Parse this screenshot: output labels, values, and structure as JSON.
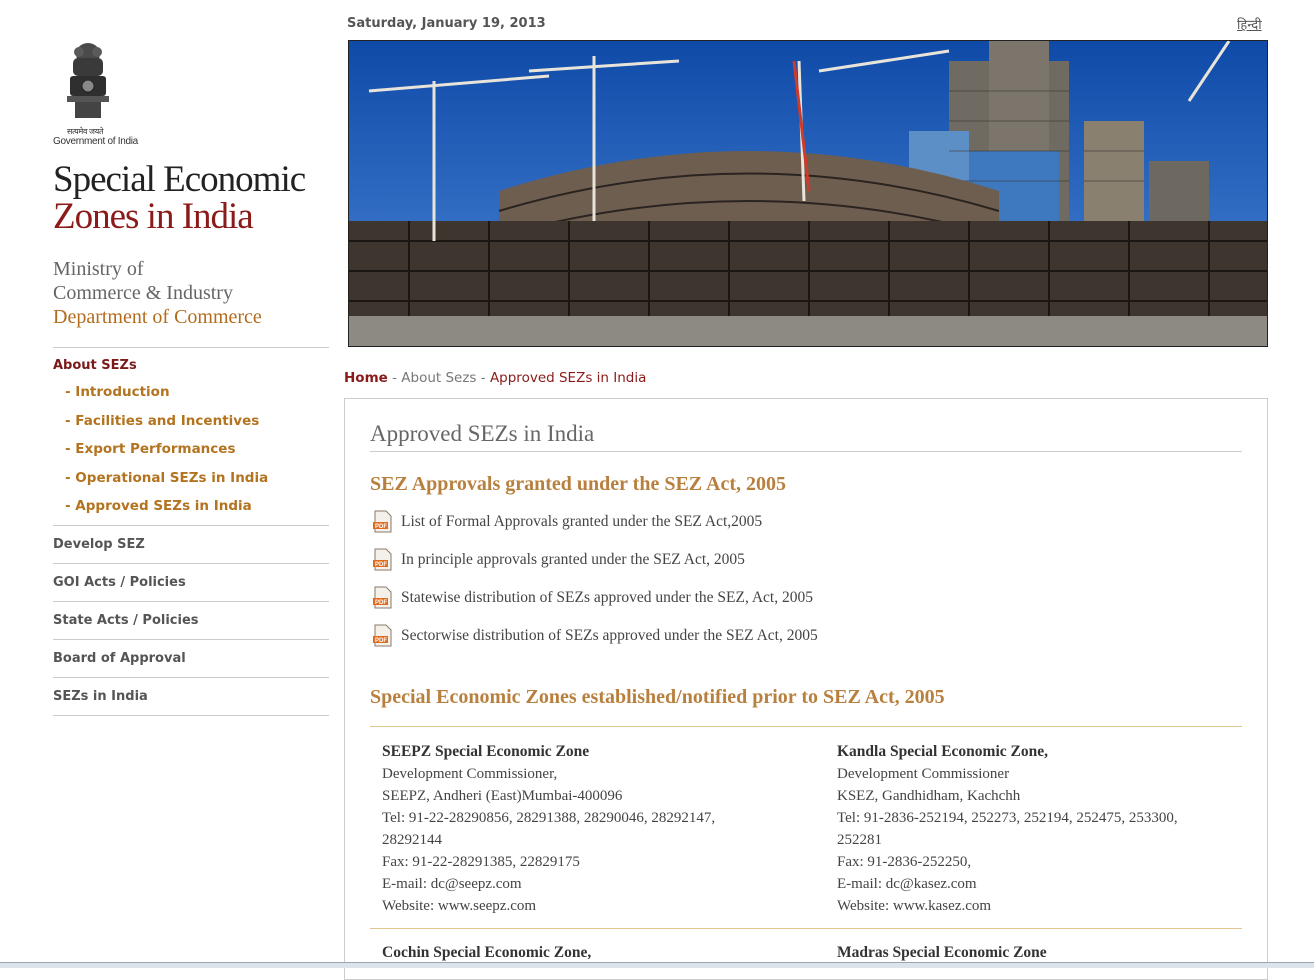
{
  "header": {
    "date": "Saturday, January 19, 2013",
    "language_link": "हिन्दी"
  },
  "branding": {
    "emblem_caption": "Government of India",
    "emblem_motto": "सत्यमेव जयते",
    "title_line1": "Special Economic",
    "title_line2": "Zones in India",
    "ministry_line1": "Ministry of",
    "ministry_line2": "Commerce & Industry",
    "department": "Department of Commerce"
  },
  "sidebar": {
    "active_section": "About SEZs",
    "sub_items": [
      {
        "label": "- Introduction"
      },
      {
        "label": "- Facilities and Incentives"
      },
      {
        "label": "- Export Performances"
      },
      {
        "label": "- Operational SEZs in India"
      },
      {
        "label": "- Approved SEZs in India"
      }
    ],
    "items": [
      {
        "label": "Develop SEZ"
      },
      {
        "label": "GOI Acts / Policies"
      },
      {
        "label": "State Acts / Policies"
      },
      {
        "label": "Board of Approval"
      },
      {
        "label": "SEZs in India"
      }
    ]
  },
  "breadcrumb": {
    "home": "Home",
    "sep": " - ",
    "parent": "About Sezs",
    "current": "Approved SEZs in India"
  },
  "main": {
    "page_title": "Approved SEZs in India",
    "section1_heading": "SEZ Approvals granted under the SEZ Act, 2005",
    "pdf_icon": "pdf-file-icon",
    "documents": [
      {
        "label": "List of Formal Approvals granted under the SEZ Act,2005"
      },
      {
        "label": "In principle approvals granted under the SEZ Act, 2005"
      },
      {
        "label": "Statewise distribution of SEZs approved under the SEZ, Act, 2005"
      },
      {
        "label": "Sectorwise distribution of SEZs approved under the SEZ Act, 2005"
      }
    ],
    "section2_heading": "Special Economic Zones established/notified prior to SEZ Act, 2005",
    "zones": [
      {
        "name": "SEEPZ Special Economic Zone",
        "line1": "Development Commissioner,",
        "line2": "SEEPZ, Andheri (East)Mumbai-400096",
        "tel": "Tel: 91-22-28290856, 28291388, 28290046, 28292147,",
        "tel_cont": "28292144",
        "fax": "Fax: 91-22-28291385, 22829175",
        "email": "E-mail: dc@seepz.com",
        "website": "Website: www.seepz.com"
      },
      {
        "name": "Kandla Special Economic Zone,",
        "line1": "Development Commissioner",
        "line2": "KSEZ, Gandhidham, Kachchh",
        "tel": "Tel: 91-2836-252194, 252273, 252194, 252475, 253300,",
        "tel_cont": "252281",
        "fax": "Fax: 91-2836-252250,",
        "email": "E-mail: dc@kasez.com",
        "website": "Website: www.kasez.com"
      },
      {
        "name": "Cochin Special Economic Zone,"
      },
      {
        "name": "Madras Special Economic Zone"
      }
    ]
  },
  "colors": {
    "maroon": "#8b1a1a",
    "gold": "#b8803e",
    "nav_gold": "#b3731f",
    "sky": "#1d5fbf"
  }
}
